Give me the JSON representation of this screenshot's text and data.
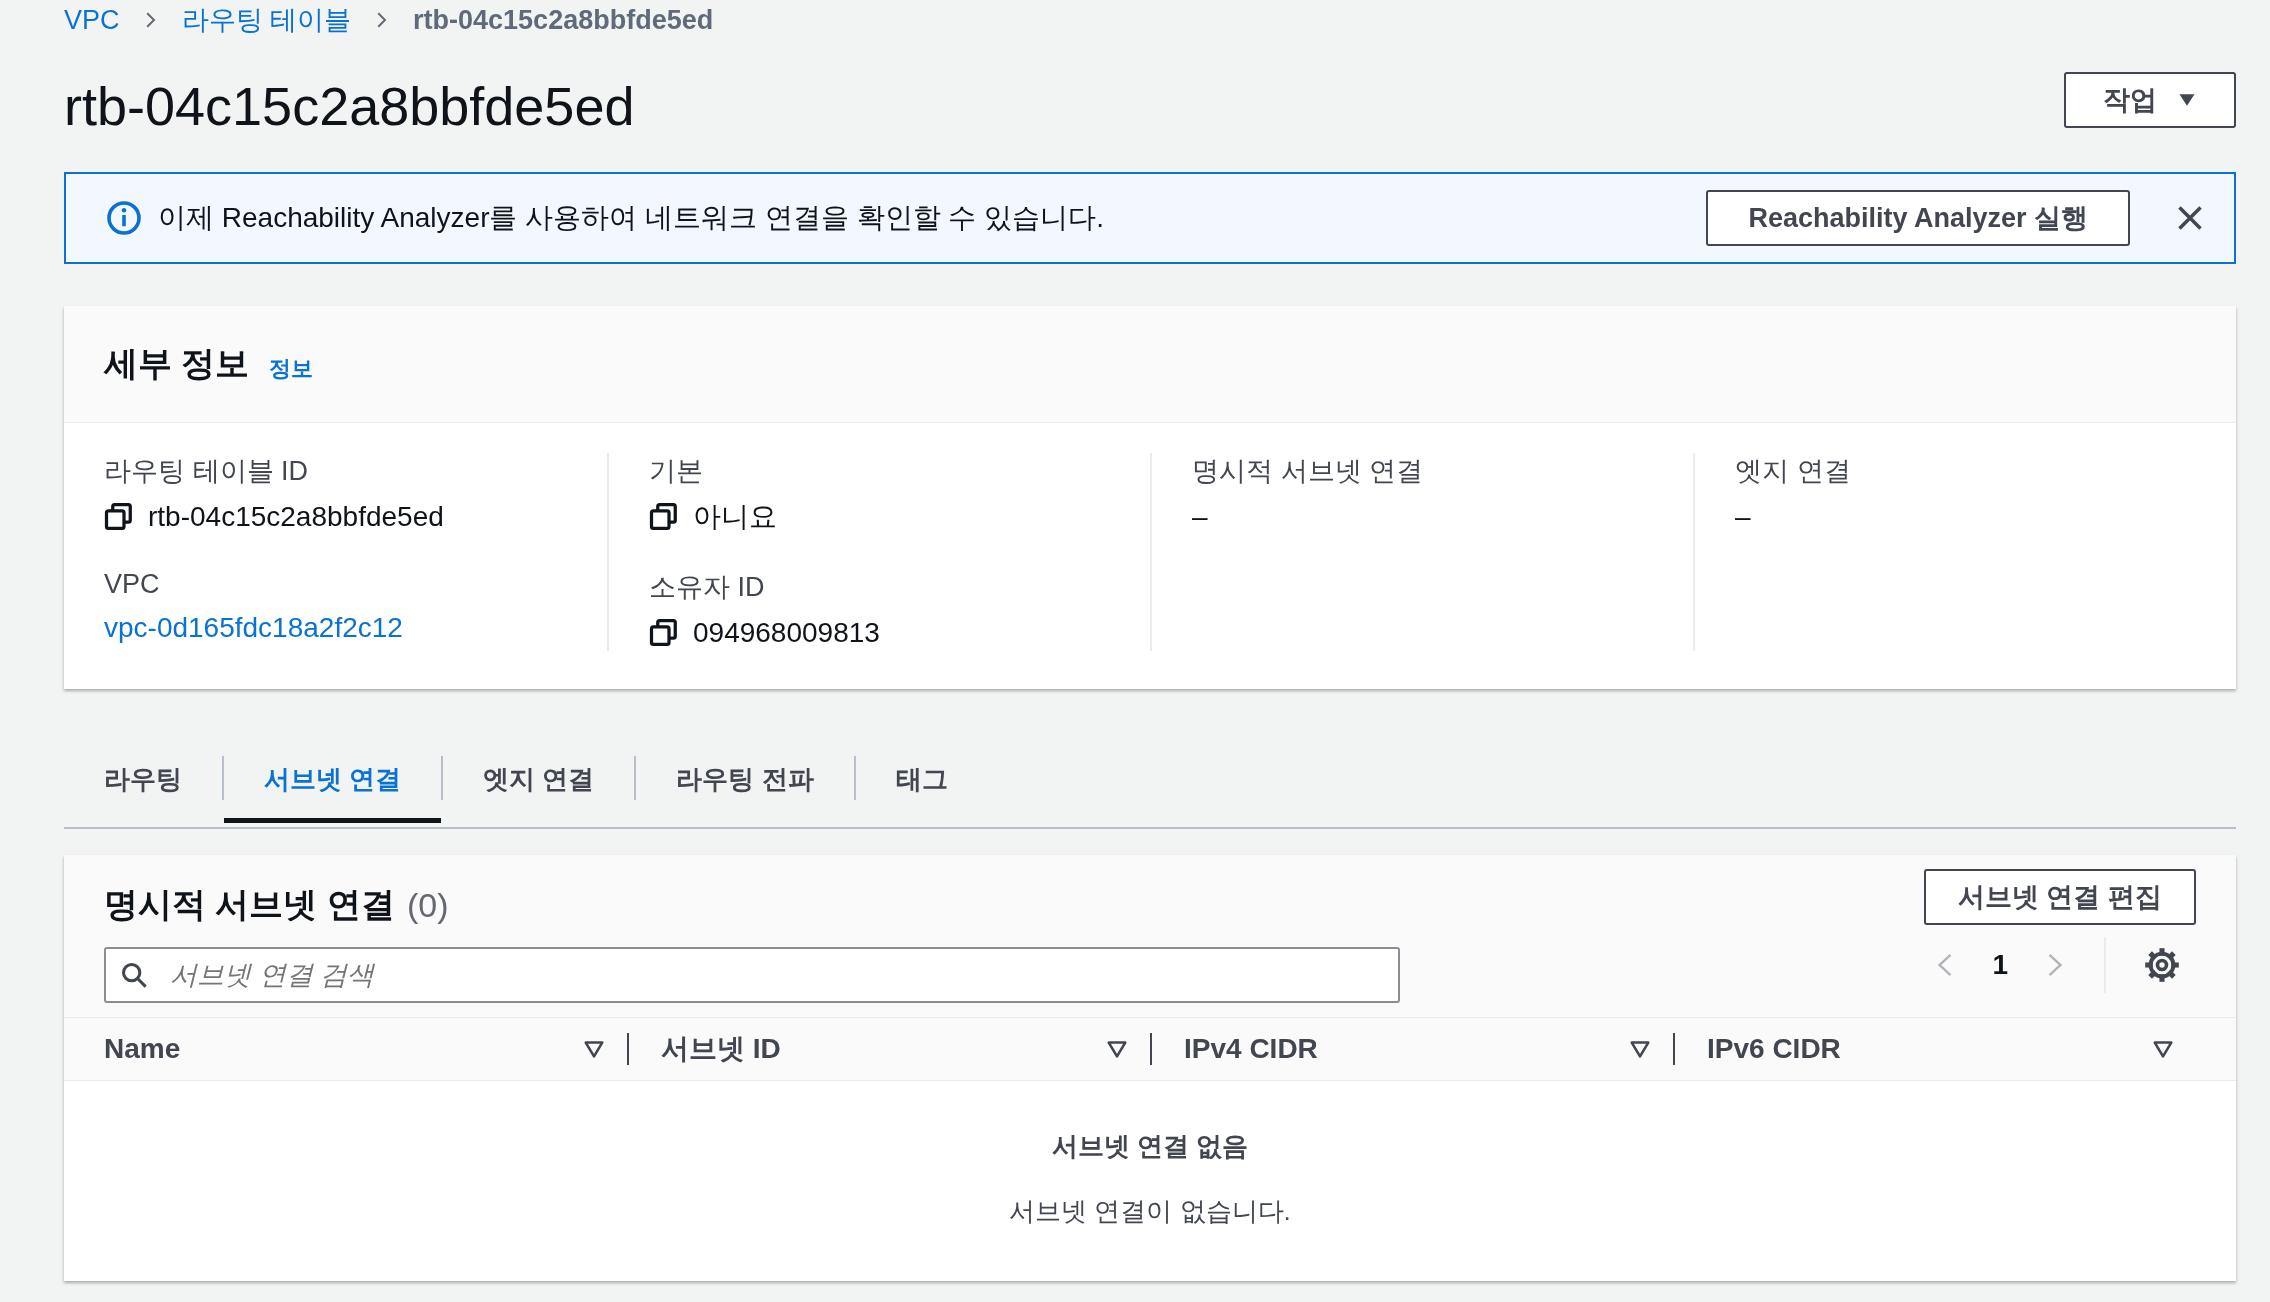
{
  "breadcrumb": [
    {
      "label": "VPC",
      "link": true
    },
    {
      "label": "라우팅 테이블",
      "link": true
    },
    {
      "label": "rtb-04c15c2a8bbfde5ed",
      "link": false
    }
  ],
  "title": "rtb-04c15c2a8bbfde5ed",
  "actions_button": "작업",
  "banner": {
    "message": "이제 Reachability Analyzer를 사용하여 네트워크 연결을 확인할 수 있습니다.",
    "button": "Reachability Analyzer 실행"
  },
  "details": {
    "heading": "세부 정보",
    "info_link": "정보",
    "columns": [
      [
        {
          "label": "라우팅 테이블 ID",
          "value": "rtb-04c15c2a8bbfde5ed",
          "kind": "copy"
        },
        {
          "label": "VPC",
          "value": "vpc-0d165fdc18a2f2c12",
          "kind": "link"
        }
      ],
      [
        {
          "label": "기본",
          "value": "아니요",
          "kind": "copy"
        },
        {
          "label": "소유자 ID",
          "value": "094968009813",
          "kind": "copy"
        }
      ],
      [
        {
          "label": "명시적 서브넷 연결",
          "value": "–",
          "kind": "text"
        }
      ],
      [
        {
          "label": "엣지 연결",
          "value": "–",
          "kind": "text"
        }
      ]
    ]
  },
  "tabs": [
    {
      "label": "라우팅",
      "selected": false
    },
    {
      "label": "서브넷 연결",
      "selected": true
    },
    {
      "label": "엣지 연결",
      "selected": false
    },
    {
      "label": "라우팅 전파",
      "selected": false
    },
    {
      "label": "태그",
      "selected": false
    }
  ],
  "table": {
    "heading": "명시적 서브넷 연결",
    "count": "(0)",
    "edit_button": "서브넷 연결 편집",
    "search_placeholder": "서브넷 연결 검색",
    "page": "1",
    "columns": [
      "Name",
      "서브넷 ID",
      "IPv4 CIDR",
      "IPv6 CIDR"
    ],
    "empty_title": "서브넷 연결 없음",
    "empty_message": "서브넷 연결이 없습니다."
  }
}
